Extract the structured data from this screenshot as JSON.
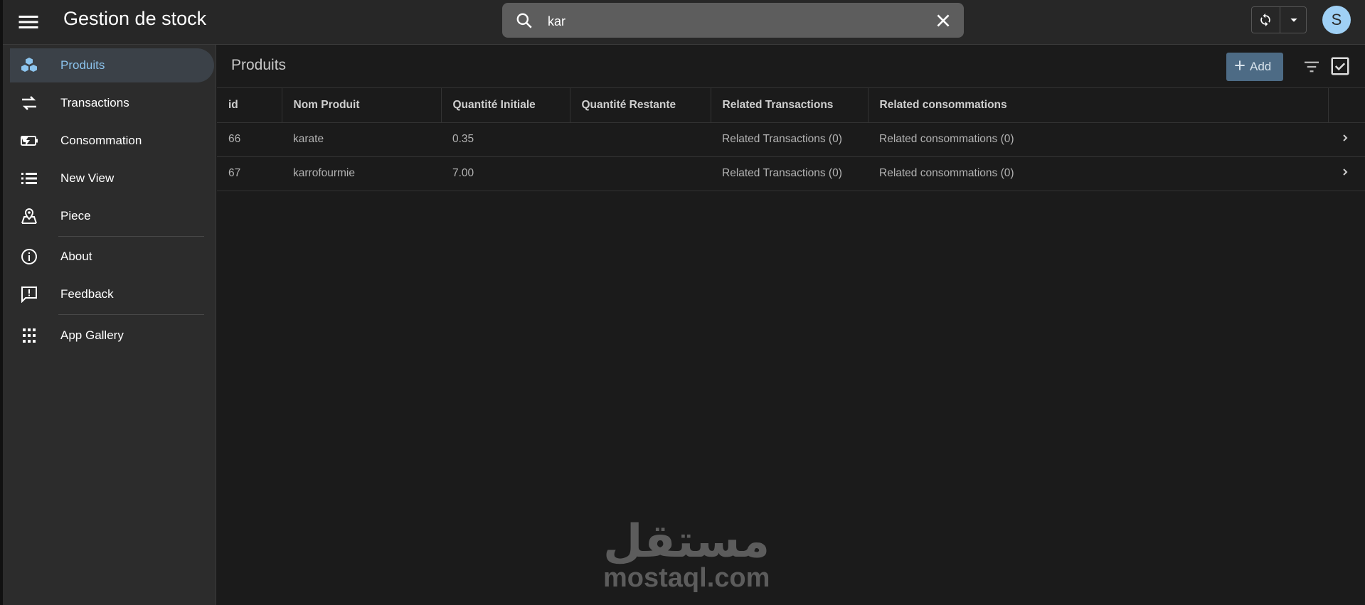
{
  "app": {
    "title": "Gestion de stock"
  },
  "search": {
    "value": "kar"
  },
  "user": {
    "avatar_letter": "S"
  },
  "sidebar": {
    "items": [
      {
        "label": "Produits",
        "icon": "cubes-icon",
        "active": true
      },
      {
        "label": "Transactions",
        "icon": "swap-arrows-icon"
      },
      {
        "label": "Consommation",
        "icon": "battery-charging-icon"
      },
      {
        "label": "New View",
        "icon": "list-icon"
      },
      {
        "label": "Piece",
        "icon": "map-pin-icon"
      },
      {
        "label": "About",
        "icon": "info-icon"
      },
      {
        "label": "Feedback",
        "icon": "feedback-icon"
      },
      {
        "label": "App Gallery",
        "icon": "grid-icon"
      }
    ]
  },
  "main": {
    "title": "Produits",
    "add_label": "Add",
    "columns": [
      "id",
      "Nom Produit",
      "Quantité Initiale",
      "Quantité Restante",
      "Related Transactions",
      "Related consommations"
    ],
    "rows": [
      {
        "id": "66",
        "nom": "karate",
        "qte_init": "0.35",
        "qte_rest": "",
        "rel_trans": "Related Transactions (0)",
        "rel_cons": "Related consommations (0)"
      },
      {
        "id": "67",
        "nom": "karrofourmie",
        "qte_init": "7.00",
        "qte_rest": "",
        "rel_trans": "Related Transactions (0)",
        "rel_cons": "Related consommations (0)"
      }
    ]
  },
  "watermark": {
    "arabic": "مستقل",
    "latin": "mostaql.com"
  },
  "colors": {
    "accent": "#8cc4ee",
    "add_button": "#4d6b85",
    "avatar": "#9fd0f5"
  }
}
